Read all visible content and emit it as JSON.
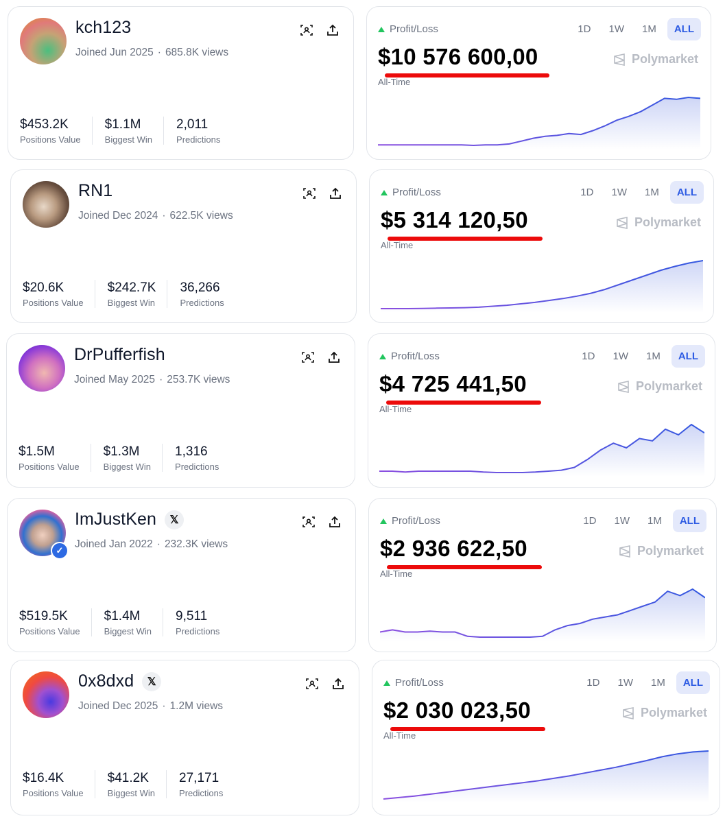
{
  "range_options": [
    "1D",
    "1W",
    "1M",
    "ALL"
  ],
  "pnl_label": "Profit/Loss",
  "timeframe_label": "All-Time",
  "brand_name": "Polymarket",
  "colors": {
    "accent": "#2d5be3",
    "underline": "#ec0b0b",
    "positive": "#22c55e"
  },
  "users": [
    {
      "username": "kch123",
      "joined": "Joined Jun 2025",
      "views": "685.8K views",
      "x_badge": false,
      "stats": [
        {
          "value": "$453.2K",
          "label": "Positions Value"
        },
        {
          "value": "$1.1M",
          "label": "Biggest Win"
        },
        {
          "value": "2,011",
          "label": "Predictions"
        }
      ],
      "profit_loss": "$10 576 600,00",
      "selected_range": "ALL"
    },
    {
      "username": "RN1",
      "joined": "Joined Dec 2024",
      "views": "622.5K views",
      "x_badge": false,
      "stats": [
        {
          "value": "$20.6K",
          "label": "Positions Value"
        },
        {
          "value": "$242.7K",
          "label": "Biggest Win"
        },
        {
          "value": "36,266",
          "label": "Predictions"
        }
      ],
      "profit_loss": "$5 314 120,50",
      "selected_range": "ALL"
    },
    {
      "username": "DrPufferfish",
      "joined": "Joined May 2025",
      "views": "253.7K views",
      "x_badge": false,
      "stats": [
        {
          "value": "$1.5M",
          "label": "Positions Value"
        },
        {
          "value": "$1.3M",
          "label": "Biggest Win"
        },
        {
          "value": "1,316",
          "label": "Predictions"
        }
      ],
      "profit_loss": "$4 725 441,50",
      "selected_range": "ALL"
    },
    {
      "username": "ImJustKen",
      "joined": "Joined Jan 2022",
      "views": "232.3K views",
      "x_badge": true,
      "x_badge_glyph": "𝕏",
      "stats": [
        {
          "value": "$519.5K",
          "label": "Positions Value"
        },
        {
          "value": "$1.4M",
          "label": "Biggest Win"
        },
        {
          "value": "9,511",
          "label": "Predictions"
        }
      ],
      "profit_loss": "$2 936 622,50",
      "selected_range": "ALL"
    },
    {
      "username": "0x8dxd",
      "joined": "Joined Dec 2025",
      "views": "1.2M views",
      "x_badge": true,
      "x_badge_glyph": "𝕏",
      "stats": [
        {
          "value": "$16.4K",
          "label": "Positions Value"
        },
        {
          "value": "$41.2K",
          "label": "Biggest Win"
        },
        {
          "value": "27,171",
          "label": "Predictions"
        }
      ],
      "profit_loss": "$2 030 023,50",
      "selected_range": "ALL"
    }
  ],
  "chart_data": [
    {
      "type": "area",
      "series": [
        {
          "values": [
            0.0,
            0.0,
            0.0,
            0.0,
            0.0,
            0.0,
            0.0,
            0.0,
            -0.01,
            0.0,
            0.0,
            0.02,
            0.08,
            0.14,
            0.18,
            0.2,
            0.24,
            0.22,
            0.3,
            0.4,
            0.52,
            0.6,
            0.7,
            0.84,
            0.98,
            0.96,
            1.0,
            0.98
          ]
        }
      ]
    },
    {
      "type": "area",
      "series": [
        {
          "values": [
            0.0,
            0.0,
            0.0,
            0.005,
            0.01,
            0.015,
            0.02,
            0.03,
            0.05,
            0.07,
            0.1,
            0.13,
            0.17,
            0.21,
            0.26,
            0.32,
            0.4,
            0.5,
            0.6,
            0.7,
            0.8,
            0.88,
            0.95,
            1.0
          ]
        }
      ]
    },
    {
      "type": "area",
      "series": [
        {
          "values": [
            0.0,
            0.0,
            -0.02,
            0.0,
            0.0,
            0.0,
            0.0,
            0.0,
            -0.02,
            -0.03,
            -0.03,
            -0.03,
            -0.02,
            0.0,
            0.02,
            0.08,
            0.25,
            0.45,
            0.6,
            0.5,
            0.7,
            0.65,
            0.9,
            0.78,
            1.0,
            0.82
          ]
        }
      ]
    },
    {
      "type": "area",
      "series": [
        {
          "values": [
            0.0,
            0.05,
            0.0,
            0.0,
            0.02,
            0.0,
            0.0,
            -0.1,
            -0.12,
            -0.12,
            -0.12,
            -0.12,
            -0.12,
            -0.1,
            0.05,
            0.15,
            0.2,
            0.3,
            0.35,
            0.4,
            0.5,
            0.6,
            0.7,
            0.95,
            0.85,
            1.0,
            0.8
          ]
        }
      ]
    },
    {
      "type": "area",
      "series": [
        {
          "values": [
            0.0,
            0.03,
            0.06,
            0.1,
            0.14,
            0.18,
            0.22,
            0.26,
            0.3,
            0.34,
            0.38,
            0.43,
            0.48,
            0.54,
            0.6,
            0.66,
            0.73,
            0.8,
            0.88,
            0.94,
            0.98,
            1.0
          ]
        }
      ]
    }
  ]
}
